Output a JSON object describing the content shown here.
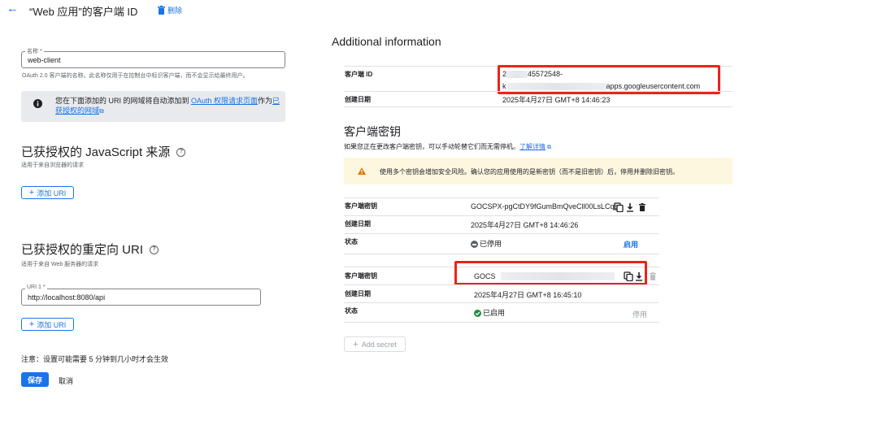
{
  "header": {
    "back_icon": "arrow-back-icon",
    "title": "“Web 应用”的客户端 ID",
    "delete_label": "删除",
    "delete_icon": "trash-icon"
  },
  "form": {
    "name_label": "名称 *",
    "name_value": "web-client",
    "name_hint": "OAuth 2.0 客户端的名称。此名称仅用于在控制台中标识客户端，而不会显示给最终用户。",
    "info_text_1": "您在下面添加的 URI 的网域将自动添加到 ",
    "info_link_1": "OAuth 权限请求页面",
    "info_text_2": "作为",
    "info_link_2a": "已",
    "info_link_2b": "获授权的网域",
    "info_icon": "info-icon",
    "js_origins_title": "已获授权的 JavaScript 来源",
    "js_origins_hint": "适用于来自浏览器的请求",
    "add_uri_label": "添加 URI",
    "redirect_title": "已获授权的重定向 URI",
    "redirect_hint": "适用于来自 Web 服务器的请求",
    "uri_label": "URI 1 *",
    "uri_value": "http://localhost:8080/api",
    "add_uri_label_2": "添加 URI",
    "note": "注意：设置可能需要 5 分钟到几小时才会生效",
    "save_label": "保存",
    "cancel_label": "取消"
  },
  "info_panel": {
    "title": "Additional information",
    "client_id_key": "客户端 ID",
    "client_id_line1": "2",
    "client_id_line1_tail": "45572548-",
    "client_id_line2": "k",
    "client_id_line2_tail": "apps.googleusercontent.com",
    "created_key": "创建日期",
    "created_value": "2025年4月27日 GMT+8 14:46:23"
  },
  "secrets": {
    "title": "客户端密钥",
    "desc": "如果您正在更改客户端密钥，可以手动轮替它们而无需停机。",
    "learn_more": "了解详情",
    "warning_icon": "warning-icon",
    "warning": "使用多个密钥会增加安全风险。确认您的应用使用的是新密钥（而不是旧密钥）后，停用并删除旧密钥。",
    "items": [
      {
        "secret_key": "客户端密钥",
        "secret_value": "GOCSPX-pgCtDY9fGumBmQveCll00LsLCqs",
        "created_key": "创建日期",
        "created_value": "2025年4月27日 GMT+8 14:46:26",
        "status_key": "状态",
        "status_value": "已停用",
        "action": "启用"
      },
      {
        "secret_key": "客户端密钥",
        "secret_value": "GOCS",
        "created_key": "创建日期",
        "created_value": "2025年4月27日 GMT+8 16:45:10",
        "status_key": "状态",
        "status_value": "已启用",
        "action": "停用"
      }
    ],
    "add_secret": "Add secret"
  },
  "colors": {
    "accent": "#1a73e8",
    "highlight_red": "#e8251b",
    "enabled_green": "#1e8e3e",
    "disabled_gray": "#5f6368",
    "warning_amber": "#e37400"
  }
}
